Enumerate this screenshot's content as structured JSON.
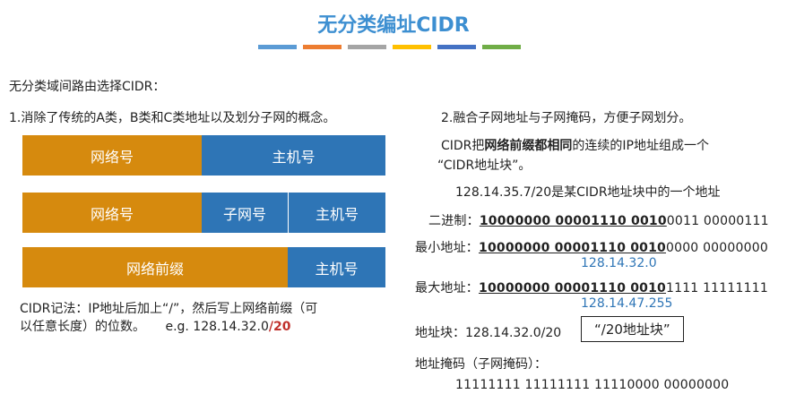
{
  "title": "无分类编址CIDR",
  "stripe_colors": [
    "#5b9bd5",
    "#ed7d31",
    "#a5a5a5",
    "#ffc000",
    "#4472c4",
    "#70ad47"
  ],
  "left": {
    "intro": "无分类域间路由选择CIDR：",
    "point1": "1.消除了传统的A类，B类和C类地址以及划分子网的概念。",
    "row1": {
      "net": "网络号",
      "host": "主机号"
    },
    "row2": {
      "net": "网络号",
      "subnet": "子网号",
      "host": "主机号"
    },
    "row3": {
      "prefix": "网络前缀",
      "host": "主机号"
    },
    "note_line1": "CIDR记法：IP地址后加上“/”，然后写上网络前缀（可",
    "note_line2_a": "以任意长度）的位数。",
    "note_eg": "e.g. 128.14.32.0",
    "note_eg_suffix": "/20"
  },
  "right": {
    "point2": "2.融合子网地址与子网掩码，方便子网划分。",
    "cidr_a": "CIDR把",
    "cidr_bold": "网络前缀都相同",
    "cidr_b": "的连续的IP地址组成一个",
    "cidr_line2": "“CIDR地址块”。",
    "example": "128.14.35.7/20是某CIDR地址块中的一个地址",
    "binary": {
      "label": "二进制：",
      "prefix": "10000000 00001110 0010",
      "rest": "0011 00000111"
    },
    "min": {
      "label": "最小地址：",
      "prefix": "10000000 00001110 0010",
      "rest": "0000 00000000",
      "dotted": "128.14.32.0"
    },
    "max": {
      "label": "最大地址：",
      "prefix": "10000000 00001110 0010",
      "rest": "1111 11111111",
      "dotted": "128.14.47.255"
    },
    "block": {
      "label": "地址块：128.14.32.0/20",
      "box": "“/20地址块”"
    },
    "mask_label": "地址掩码（子网掩码）：",
    "mask_value": "11111111 11111111 11110000 00000000"
  }
}
